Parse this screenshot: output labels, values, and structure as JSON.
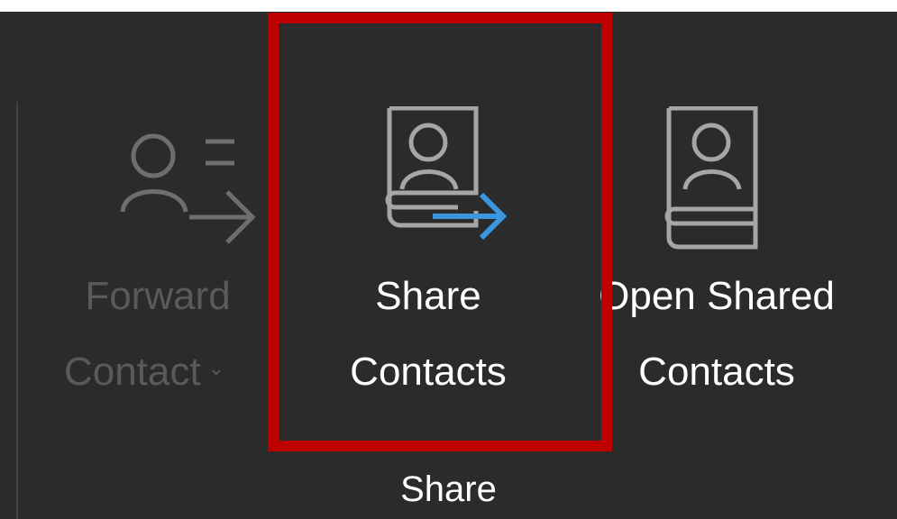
{
  "ribbon": {
    "group_label": "Share",
    "commands": {
      "forward_contact": {
        "line1": "Forward",
        "line2": "Contact",
        "icon": "person-forward-icon",
        "enabled": false,
        "has_dropdown": true
      },
      "share_contacts": {
        "line1": "Share",
        "line2": "Contacts",
        "icon": "share-address-book-icon",
        "enabled": true
      },
      "open_shared_contacts": {
        "line1": "Open Shared",
        "line2": "Contacts",
        "icon": "address-book-icon",
        "enabled": true
      }
    }
  },
  "colors": {
    "ribbon_bg": "#2b2b2b",
    "highlight": "#bf0000",
    "arrow_accent": "#3a96dd",
    "disabled_text": "#5a5a5a",
    "text": "#ffffff"
  }
}
